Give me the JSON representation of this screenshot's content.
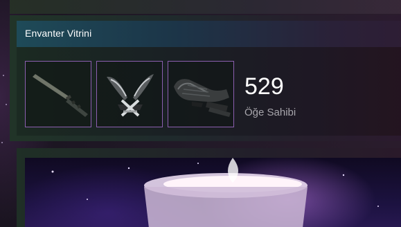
{
  "showcase": {
    "title": "Envanter Vitrini",
    "items": [
      {
        "name": "combat-knife",
        "icon": "knife-icon"
      },
      {
        "name": "shadow-daggers",
        "icon": "daggers-icon"
      },
      {
        "name": "gloves",
        "icon": "gloves-icon"
      }
    ],
    "item_count": "529",
    "item_count_label": "Öğe Sahibi"
  },
  "colors": {
    "slot_border": "#8c5fb0",
    "header_accent": "#1e4a58",
    "count_text": "#ffffff",
    "label_text": "#a8a6ac"
  },
  "artwork": {
    "icon": "candle-artwork"
  }
}
